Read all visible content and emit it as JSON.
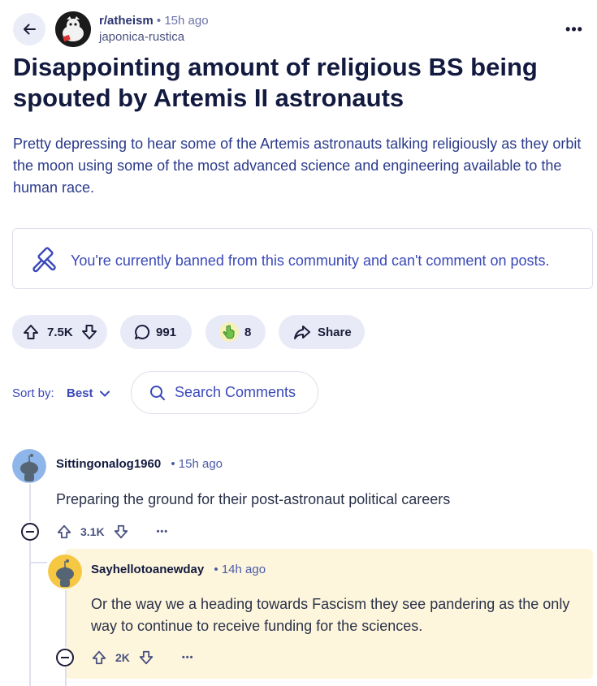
{
  "header": {
    "subreddit": "r/atheism",
    "separator": "•",
    "time": "15h ago",
    "author": "japonica-rustica",
    "more_label": "•••"
  },
  "post": {
    "title": "Disappointing amount of religious BS being spouted by Artemis II astronauts",
    "body": "Pretty depressing to hear some of the Artemis astronauts talking religiously as they orbit the moon using some of the most advanced science and engineering available to the human race."
  },
  "ban_notice": {
    "text": "You're currently banned from this community and can't comment on posts."
  },
  "actions": {
    "votes": "7.5K",
    "comments": "991",
    "awards": "8",
    "share_label": "Share"
  },
  "sort": {
    "label": "Sort by:",
    "value": "Best",
    "search_placeholder": "Search Comments"
  },
  "comments": [
    {
      "user": "Sittingonalog1960",
      "separator": "•",
      "time": "15h ago",
      "text": "Preparing the ground for their post-astronaut political careers",
      "votes": "3.1K",
      "more_label": "•••"
    },
    {
      "user": "Sayhellotoanewday",
      "separator": "•",
      "time": "14h ago",
      "text": "Or the way we a heading towards Fascism they see pandering as the only way to continue to receive funding for the sciences.",
      "votes": "2K",
      "more_label": "•••"
    }
  ],
  "colors": {
    "accent": "#3a48b8",
    "pill_bg": "#e8ebf7",
    "highlight_bg": "#fdf6dc"
  }
}
